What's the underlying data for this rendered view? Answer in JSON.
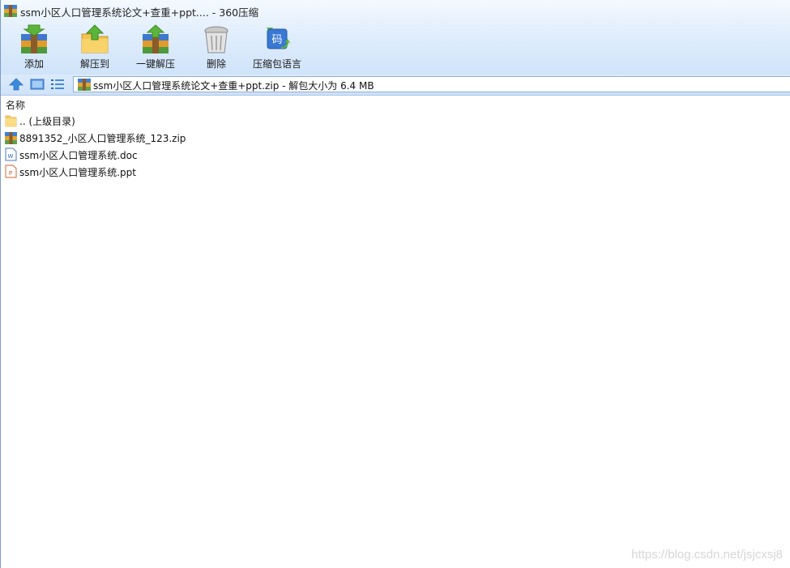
{
  "window": {
    "title": "ssm小区人口管理系统论文+查重+ppt.... - 360压缩",
    "icon": "archive-icon"
  },
  "toolbar": {
    "buttons": [
      {
        "label": "添加",
        "icon": "add-archive-icon"
      },
      {
        "label": "解压到",
        "icon": "extract-to-icon"
      },
      {
        "label": "一键解压",
        "icon": "one-click-extract-icon"
      },
      {
        "label": "删除",
        "icon": "delete-bin-icon"
      },
      {
        "label": "压缩包语言",
        "icon": "archive-language-icon"
      }
    ]
  },
  "nav": {
    "up_icon": "up-arrow-icon",
    "view_icon": "thumbnail-view-icon",
    "list_icon": "list-view-icon",
    "address_text": "ssm小区人口管理系统论文+查重+ppt.zip - 解包大小为 6.4 MB"
  },
  "list": {
    "column_name": "名称",
    "items": [
      {
        "name": ".. (上级目录)",
        "icon": "folder-icon"
      },
      {
        "name": "8891352_小区人口管理系统_123.zip",
        "icon": "zip-archive-icon"
      },
      {
        "name": "ssm小区人口管理系统.doc",
        "icon": "word-doc-icon"
      },
      {
        "name": "ssm小区人口管理系统.ppt",
        "icon": "powerpoint-icon"
      }
    ]
  },
  "watermark": "https://blog.csdn.net/jsjcxsj8",
  "colors": {
    "header_top": "#f4f9ff",
    "header_bottom": "#cfe3fa",
    "border_blue": "#7a9cc9"
  }
}
